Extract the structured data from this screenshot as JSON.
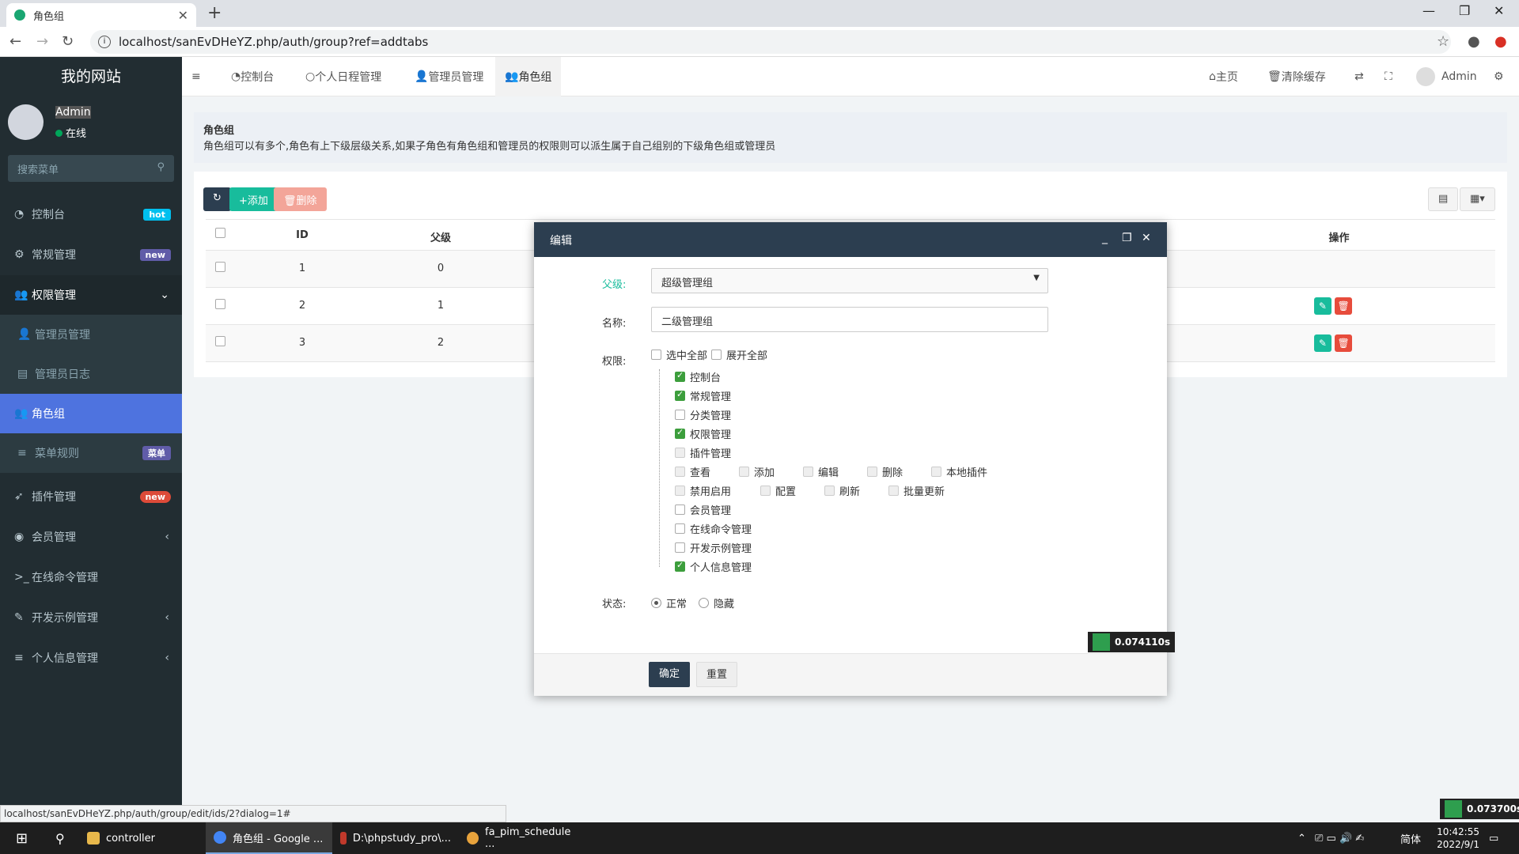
{
  "browser": {
    "tab_title": "角色组",
    "url": "localhost/sanEvDHeYZ.php/auth/group?ref=addtabs",
    "status_url": "localhost/sanEvDHeYZ.php/auth/group/edit/ids/2?dialog=1#"
  },
  "sidebar": {
    "site_name": "我的网站",
    "user_name": "Admin",
    "user_status": "在线",
    "search_placeholder": "搜索菜单",
    "items": [
      {
        "label": "控制台",
        "badge": "hot",
        "badge_color": "#00c0ef"
      },
      {
        "label": "常规管理",
        "badge": "new",
        "badge_color": "#605ca8"
      },
      {
        "label": "权限管理"
      },
      {
        "label": "管理员管理"
      },
      {
        "label": "管理员日志"
      },
      {
        "label": "角色组"
      },
      {
        "label": "菜单规则",
        "badge": "菜单",
        "badge_color": "#605ca8"
      },
      {
        "label": "插件管理",
        "badge": "new",
        "badge_color": "#dd4b39"
      },
      {
        "label": "会员管理"
      },
      {
        "label": "在线命令管理"
      },
      {
        "label": "开发示例管理"
      },
      {
        "label": "个人信息管理"
      }
    ]
  },
  "topnav": {
    "tabs": [
      "控制台",
      "个人日程管理",
      "管理员管理",
      "角色组"
    ],
    "home": "主页",
    "clear_cache": "清除缓存",
    "user": "Admin"
  },
  "page": {
    "title": "角色组",
    "description": "角色组可以有多个,角色有上下级层级关系,如果子角色有角色组和管理员的权限则可以派生属于自己组别的下级角色组或管理员",
    "add_label": "添加",
    "delete_label": "删除",
    "columns": {
      "id": "ID",
      "parent": "父级",
      "ops": "操作"
    },
    "rows": [
      {
        "id": "1",
        "parent": "0"
      },
      {
        "id": "2",
        "parent": "1"
      },
      {
        "id": "3",
        "parent": "2"
      }
    ]
  },
  "dialog": {
    "title": "编辑",
    "parent_label": "父级:",
    "parent_value": "超级管理组",
    "name_label": "名称:",
    "name_value": "二级管理组",
    "perm_label": "权限:",
    "select_all": "选中全部",
    "expand_all": "展开全部",
    "tree": [
      {
        "label": "控制台",
        "checked": true
      },
      {
        "label": "常规管理",
        "checked": true
      },
      {
        "label": "分类管理",
        "checked": false
      },
      {
        "label": "权限管理",
        "checked": true
      },
      {
        "label": "插件管理",
        "checked": false
      }
    ],
    "plugin_children": [
      "查看",
      "添加",
      "编辑",
      "删除",
      "本地插件",
      "禁用启用",
      "配置",
      "刷新",
      "批量更新"
    ],
    "tree2": [
      {
        "label": "会员管理",
        "checked": false
      },
      {
        "label": "在线命令管理",
        "checked": false
      },
      {
        "label": "开发示例管理",
        "checked": false
      },
      {
        "label": "个人信息管理",
        "checked": true
      }
    ],
    "status_label": "状态:",
    "status_normal": "正常",
    "status_hidden": "隐藏",
    "ok": "确定",
    "reset": "重置",
    "timer": "0.074110s"
  },
  "page_timer": "0.073700s",
  "taskbar": {
    "items": [
      "controller",
      "角色组 - Google ...",
      "D:\\phpstudy_pro\\...",
      "fa_pim_schedule ..."
    ],
    "ime": "简体",
    "time": "10:42:55",
    "date": "2022/9/1"
  }
}
